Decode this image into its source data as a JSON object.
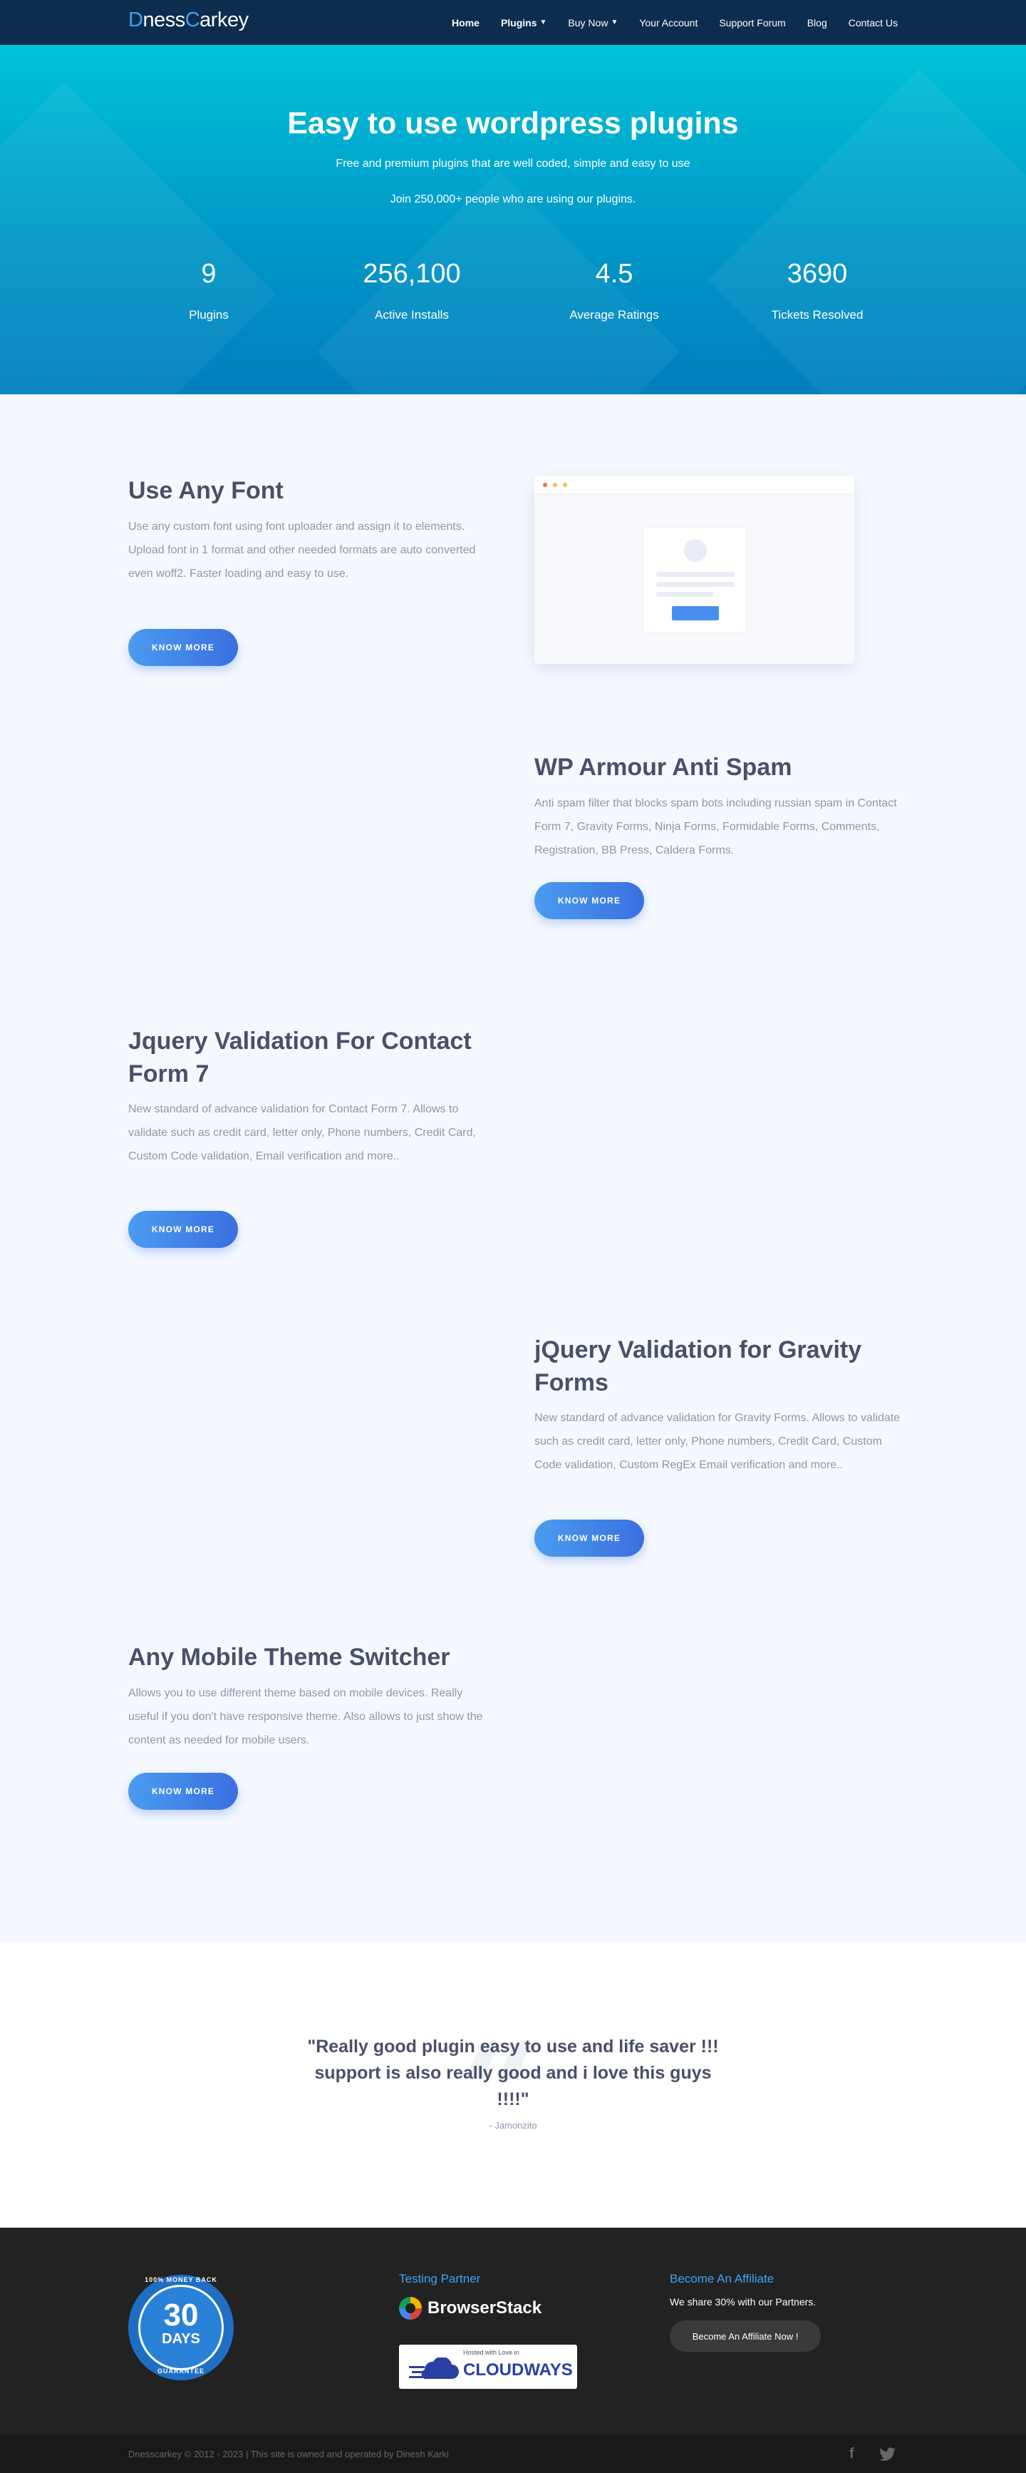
{
  "nav": {
    "logo_prefix": "D",
    "logo_mid": "ness",
    "logo_c": "C",
    "logo_suffix": "arkey",
    "items": [
      {
        "label": "Home",
        "dropdown": false
      },
      {
        "label": "Plugins",
        "dropdown": true
      },
      {
        "label": "Buy Now",
        "dropdown": true
      },
      {
        "label": "Your Account",
        "dropdown": false
      },
      {
        "label": "Support Forum",
        "dropdown": false
      },
      {
        "label": "Blog",
        "dropdown": false
      },
      {
        "label": "Contact Us",
        "dropdown": false
      }
    ]
  },
  "hero": {
    "title": "Easy to use wordpress plugins",
    "subtitle": "Free and premium plugins that are well coded, simple and easy to use",
    "join": "Join 250,000+ people who are using our plugins.",
    "stats": [
      {
        "number": "9",
        "label": "Plugins"
      },
      {
        "number": "256,100",
        "label": "Active Installs"
      },
      {
        "number": "4.5",
        "label": "Average Ratings"
      },
      {
        "number": "3690",
        "label": "Tickets Resolved"
      }
    ]
  },
  "features": [
    {
      "title": "Use Any Font",
      "desc": "Use any custom font using font uploader and assign it to elements. Upload font in 1 format and other needed formats are auto converted even woff2. Faster loading and easy to use.",
      "button": "KNOW MORE"
    },
    {
      "title": "WP Armour Anti Spam",
      "desc": "Anti spam filter that blocks spam bots including russian spam in Contact Form 7, Gravity Forms, Ninja Forms, Formidable Forms, Comments, Registration, BB Press, Caldera Forms.",
      "button": "KNOW MORE"
    },
    {
      "title": "Jquery Validation For Contact Form 7",
      "desc": "New standard of advance validation for Contact Form 7. Allows to validate such as credit card, letter only, Phone numbers, Credit Card, Custom Code validation, Email verification and more..",
      "button": "KNOW MORE"
    },
    {
      "title": "jQuery Validation for Gravity Forms",
      "desc": "New standard of advance validation for Gravity Forms. Allows to validate such as credit card, letter only, Phone numbers, Credit Card, Custom Code validation, Custom RegEx Email verification and more..",
      "button": "KNOW MORE"
    },
    {
      "title": "Any Mobile Theme Switcher",
      "desc": "Allows you to use different theme based on mobile devices. Really useful if you don't have responsive theme. Also allows to just show the content as needed for mobile users.",
      "button": "KNOW MORE"
    }
  ],
  "testimonial": {
    "quote": "\"Really good plugin easy to use and life saver !!! support is also really good and i love this guys !!!!\"",
    "author": "- Jamonzito"
  },
  "footer": {
    "badge": {
      "top": "100% MONEY BACK",
      "number": "30",
      "days": "DAYS",
      "bottom": "GUARANTEE"
    },
    "testing_partner": "Testing Partner",
    "browserstack": "BrowserStack",
    "cloudways_small": "Hosted with Love in",
    "cloudways": "CLOUDWAYS",
    "affiliate_title": "Become An Affiliate",
    "affiliate_text": "We share 30% with our Partners.",
    "affiliate_button": "Become An Affiliate Now !",
    "copyright": "Dnesscarkey © 2012 - 2023 | This site is owned and operated by Dinesh Karki",
    "social": [
      "f",
      "twitter"
    ]
  },
  "colors": {
    "nav_bg": "#0c2d4e",
    "accent": "#3ea2f5",
    "button": "#3a6fe0",
    "heading": "#4a4f6a",
    "footer_bg": "#222222"
  }
}
